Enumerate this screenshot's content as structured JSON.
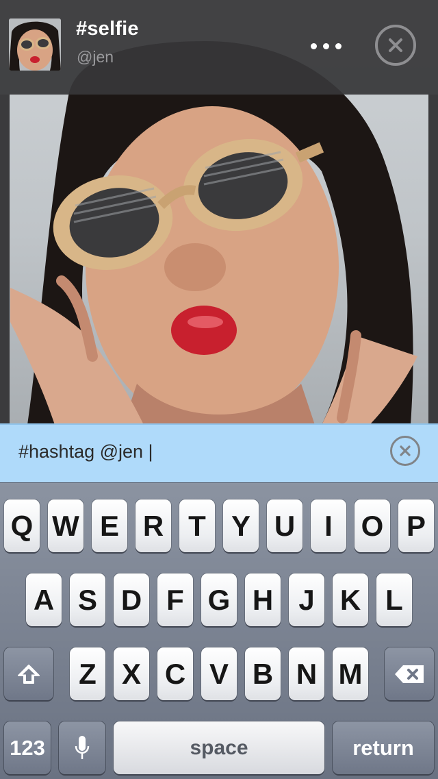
{
  "post": {
    "title": "#selfie",
    "handle": "@jen"
  },
  "comment_input": {
    "value": "#hashtag @jen |"
  },
  "keyboard": {
    "row1": [
      "Q",
      "W",
      "E",
      "R",
      "T",
      "Y",
      "U",
      "I",
      "O",
      "P"
    ],
    "row2": [
      "A",
      "S",
      "D",
      "F",
      "G",
      "H",
      "J",
      "K",
      "L"
    ],
    "row3": [
      "Z",
      "X",
      "C",
      "V",
      "B",
      "N",
      "M"
    ],
    "numbers_label": "123",
    "space_label": "space",
    "return_label": "return"
  },
  "colors": {
    "header_bg": "#373739",
    "input_bar_bg": "#afdafa",
    "keyboard_bg": "#7a8292",
    "lipstick": "#c8202e"
  },
  "icons": [
    "more-icon",
    "close-icon",
    "clear-icon",
    "shift-icon",
    "backspace-icon",
    "microphone-icon"
  ]
}
